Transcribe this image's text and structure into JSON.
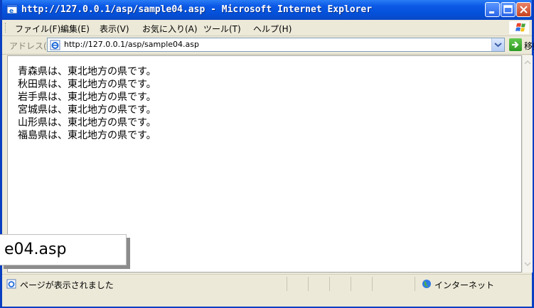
{
  "window": {
    "title": "http://127.0.0.1/asp/sample04.asp - Microsoft Internet Explorer"
  },
  "menu": {
    "items": [
      "ファイル(F)",
      "編集(E)",
      "表示(V)",
      "お気に入り(A)",
      "ツール(T)",
      "ヘルプ(H)"
    ]
  },
  "address": {
    "label": "アドレス(D)",
    "url": "http://127.0.0.1/asp/sample04.asp",
    "go_label": "移動"
  },
  "content": {
    "lines": [
      "青森県は、東北地方の県です。",
      "秋田県は、東北地方の県です。",
      "岩手県は、東北地方の県です。",
      "宮城県は、東北地方の県です。",
      "山形県は、東北地方の県です。",
      "福島県は、東北地方の県です。"
    ]
  },
  "status": {
    "text": "ページが表示されました",
    "zone": "インターネット"
  },
  "callout": {
    "text": "e04.asp"
  },
  "icons": {
    "title": "ie-icon",
    "minimize": "minimize-icon",
    "maximize": "maximize-icon",
    "close": "close-icon",
    "go": "go-arrow-icon",
    "zone": "globe-icon"
  },
  "colors": {
    "titlebar": "#0450d8",
    "close_button": "#c7421e",
    "go_button": "#2e9a22"
  }
}
